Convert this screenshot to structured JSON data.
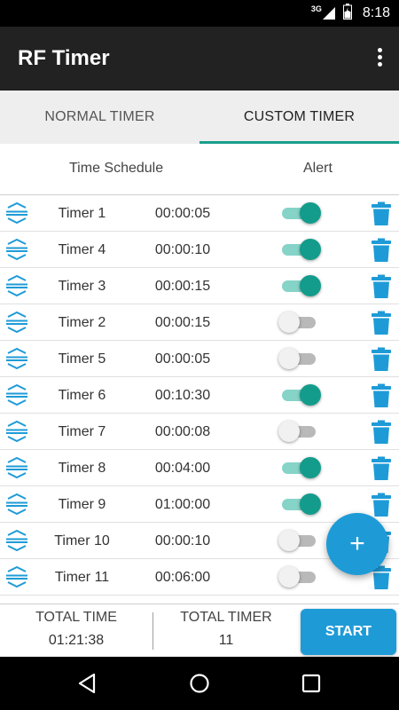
{
  "status_bar": {
    "network": "3G",
    "time": "8:18"
  },
  "app_bar": {
    "title": "RF Timer"
  },
  "tabs": [
    {
      "label": "NORMAL TIMER",
      "active": false
    },
    {
      "label": "CUSTOM TIMER",
      "active": true
    }
  ],
  "columns": {
    "schedule": "Time Schedule",
    "alert": "Alert"
  },
  "timers": [
    {
      "name": "Timer 1",
      "duration": "00:00:05",
      "alert": true
    },
    {
      "name": "Timer 4",
      "duration": "00:00:10",
      "alert": true
    },
    {
      "name": "Timer 3",
      "duration": "00:00:15",
      "alert": true
    },
    {
      "name": "Timer 2",
      "duration": "00:00:15",
      "alert": false
    },
    {
      "name": "Timer 5",
      "duration": "00:00:05",
      "alert": false
    },
    {
      "name": "Timer 6",
      "duration": "00:10:30",
      "alert": true
    },
    {
      "name": "Timer 7",
      "duration": "00:00:08",
      "alert": false
    },
    {
      "name": "Timer 8",
      "duration": "00:04:00",
      "alert": true
    },
    {
      "name": "Timer 9",
      "duration": "01:00:00",
      "alert": true
    },
    {
      "name": "Timer 10",
      "duration": "00:00:10",
      "alert": false
    },
    {
      "name": "Timer 11",
      "duration": "00:06:00",
      "alert": false
    }
  ],
  "fab": {
    "label": "+"
  },
  "footer": {
    "total_time_label": "TOTAL TIME",
    "total_time_value": "01:21:38",
    "total_timer_label": "TOTAL TIMER",
    "total_timer_value": "11",
    "start_label": "START"
  },
  "colors": {
    "accent": "#1e9bd7",
    "toggle_on": "#139c8b",
    "tab_indicator": "#1a9e8c",
    "app_bar": "#222222"
  },
  "icons": {
    "reorder": "reorder-icon",
    "delete": "trash-icon",
    "overflow": "more-vert-icon",
    "add": "plus-icon"
  }
}
